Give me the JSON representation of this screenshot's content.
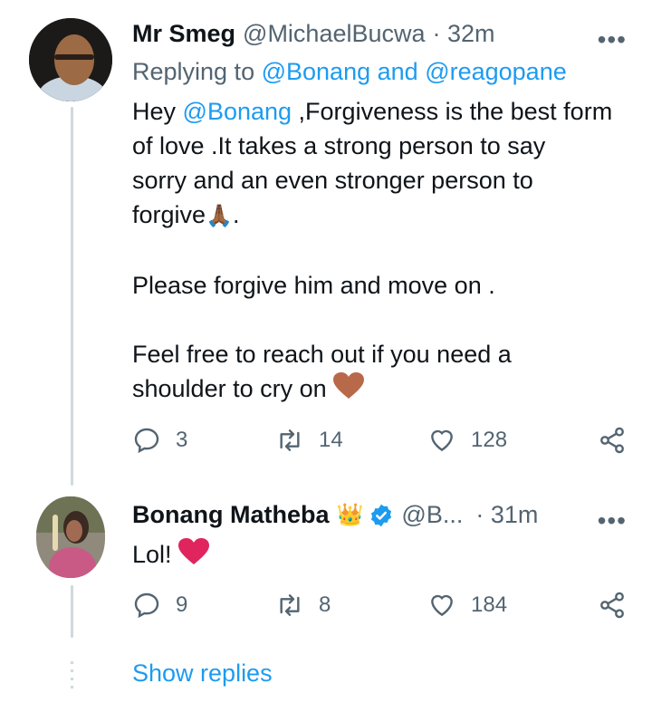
{
  "tweet1": {
    "display_name": "Mr Smeg",
    "handle": "@MichaelBucwa",
    "time": "· 32m",
    "more": "•••",
    "replying_prefix": "Replying to",
    "replying_user1": "@Bonang",
    "replying_and": "and",
    "replying_user2": "@reagopane",
    "lines": {
      "l1_prefix": "Hey",
      "l1_mention": "@Bonang",
      "l1_rest": ",Forgiveness is the best form",
      "l2": "of love .It takes a strong person to say",
      "l3": "sorry and an even stronger person to",
      "l4": "forgive",
      "l4_emoji": "🙏🏾",
      "l4_end": ".",
      "l5": "Please forgive him and move on .",
      "l6": "Feel free to reach out if you need a",
      "l7": "shoulder to cry on",
      "l7_emoji_name": "brown-heart-icon"
    },
    "reply_count": "3",
    "retweet_count": "14",
    "like_count": "128"
  },
  "tweet2": {
    "display_name": "Bonang Matheba",
    "crown_emoji": "👑",
    "handle": "@B...",
    "time": "· 31m",
    "more": "•••",
    "text": "Lol!",
    "text_emoji_name": "red-heart-icon",
    "reply_count": "9",
    "retweet_count": "8",
    "like_count": "184"
  },
  "show_replies": "Show replies",
  "colors": {
    "link": "#1d9bf0",
    "muted": "#536471",
    "verified": "#1d9bf0",
    "brown_heart": "#b8694a",
    "red_heart": "#e0245e"
  }
}
